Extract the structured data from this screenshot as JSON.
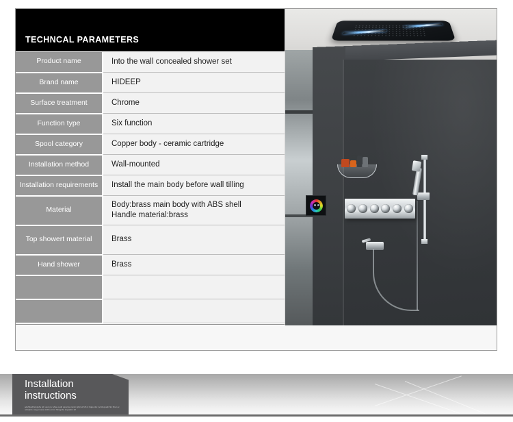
{
  "spec_card": {
    "header": {
      "title": "TECHNCAL PARAMETERS"
    },
    "rows": [
      {
        "label": "Product name",
        "value": "Into the wall concealed shower set",
        "value2": ""
      },
      {
        "label": "Brand name",
        "value": "HIDEEP",
        "value2": ""
      },
      {
        "label": "Surface treatment",
        "value": "Chrome",
        "value2": ""
      },
      {
        "label": "Function type",
        "value": "Six function",
        "value2": ""
      },
      {
        "label": "Spool category",
        "value": "Copper body - ceramic cartridge",
        "value2": ""
      },
      {
        "label": "Installation method",
        "value": "Wall-mounted",
        "value2": ""
      },
      {
        "label": "Installation requirements",
        "value": "Install the main body before wall tilling",
        "value2": ""
      },
      {
        "label": "Material",
        "value": "Body:brass main body with ABS shell",
        "value2": "Handle material:brass"
      },
      {
        "label": "Top showert material",
        "value": "Brass",
        "value2": ""
      },
      {
        "label": "Hand shower",
        "value": "Brass",
        "value2": ""
      },
      {
        "label": "",
        "value": "",
        "value2": ""
      },
      {
        "label": "",
        "value": "",
        "value2": ""
      }
    ]
  },
  "product_photo": {
    "caption": "concealed wall shower set installed in dark charcoal shower enclosure",
    "elements": {
      "ceiling_rain_panel": "ceiling-rain-shower-panel",
      "led_light_strips": "blue-led-light-strip",
      "rgb_control_pad": "rgb-led-control-pad",
      "valve_bar": "six-knob-thermostatic-valve",
      "knob_count": 6,
      "hand_shower": "hand-shower-on-slide-rail",
      "corner_shelf": "corner-shelf-with-bottles",
      "wall_mixer": "wall-mixer-with-hose"
    },
    "colors": {
      "wall": "#383b3e",
      "ceiling": "#dedddb",
      "chrome": "#e6eaec",
      "led_blue": "#7fc4ff"
    }
  },
  "footer": {
    "tag_title_line1": "Installation",
    "tag_title_line2": "instructions",
    "tag_subtext": "adefnksdhal qwhe iqh uocq re whse oeqh ascvxws ioreb iqbd sdf dh ix bqde dsx cvzdvuj adn fkn hben wnd kqbd o asg oi aws ohdfu oczxc hdiogsbn icqoasbn idf"
  },
  "colors": {
    "header_bg": "#000000",
    "label_cell_bg": "#989898",
    "value_cell_bg": "#f2f2f2",
    "card_border": "#9a9a9a",
    "footer_tag_bg": "#58585a",
    "page_bg": "#ffffff"
  }
}
